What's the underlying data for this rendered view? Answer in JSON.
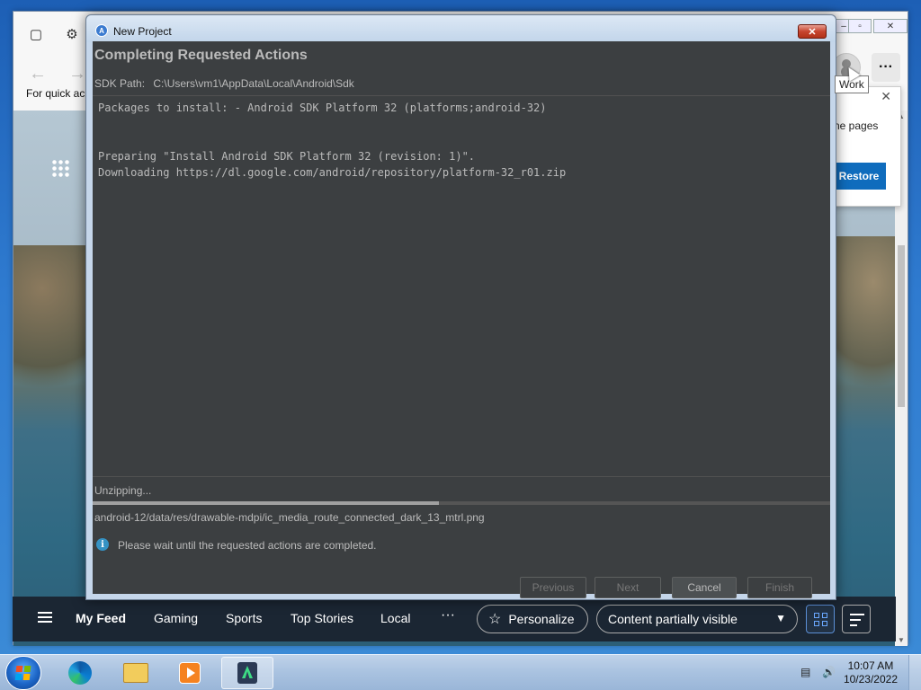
{
  "browser": {
    "quick_access": "For quick ac",
    "tooltip": "Work",
    "restore_text": "ne pages",
    "restore_button": "Restore"
  },
  "feed": {
    "items": [
      "My Feed",
      "Gaming",
      "Sports",
      "Top Stories",
      "Local"
    ],
    "more": "···",
    "personalize": "Personalize",
    "content_select": "Content partially visible"
  },
  "dialog": {
    "title": "New Project",
    "heading": "Completing Requested Actions",
    "sdk_path_label": "SDK Path:",
    "sdk_path_value": "C:\\Users\\vm1\\AppData\\Local\\Android\\Sdk",
    "log_lines": [
      "Packages to install: - Android SDK Platform 32 (platforms;android-32)",
      "",
      "",
      "Preparing \"Install Android SDK Platform 32 (revision: 1)\".",
      "Downloading https://dl.google.com/android/repository/platform-32_r01.zip"
    ],
    "progress_label": "Unzipping...",
    "progress_fraction": 0.47,
    "current_file": "android-12/data/res/drawable-mdpi/ic_media_route_connected_dark_13_mtrl.png",
    "info_message": "Please wait until the requested actions are completed.",
    "buttons": {
      "previous": "Previous",
      "next": "Next",
      "cancel": "Cancel",
      "finish": "Finish"
    }
  },
  "taskbar": {
    "time": "10:07 AM",
    "date": "10/23/2022"
  }
}
